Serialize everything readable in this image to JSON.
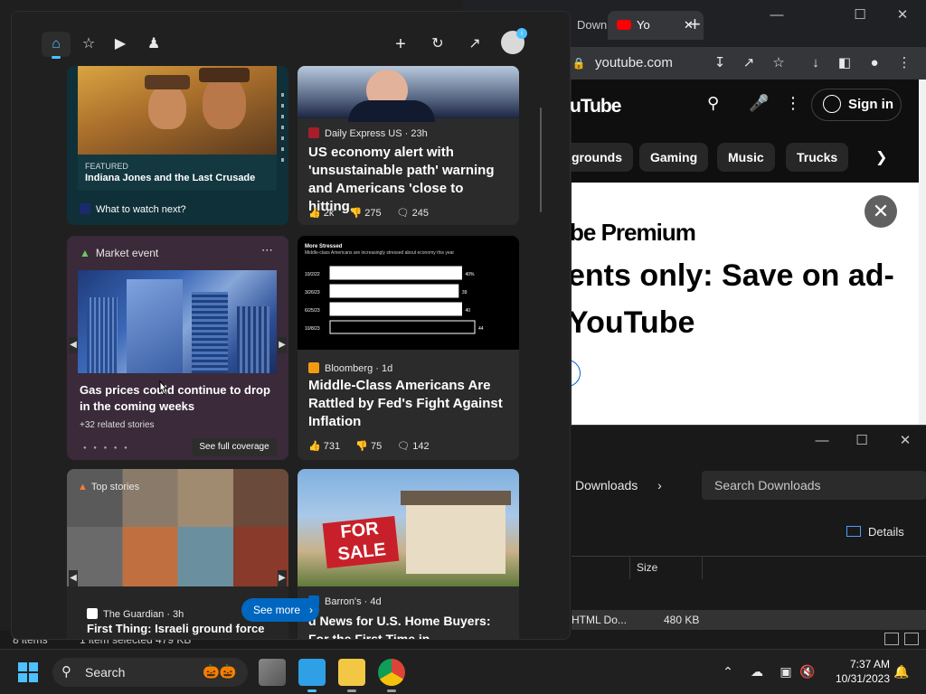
{
  "chrome": {
    "tabs": [
      {
        "label": "Downl"
      },
      {
        "label": "Yo",
        "close": "✕"
      }
    ],
    "new_tab": "+",
    "url": "youtube.com",
    "youtube": {
      "logo_text": "uTube",
      "sign_in": "Sign in",
      "chips": [
        "grounds",
        "Gaming",
        "Music",
        "Trucks"
      ],
      "premium_brand": "be Premium",
      "premium_line1": "ents only: Save on ad-",
      "premium_line2": "YouTube"
    }
  },
  "explorer": {
    "breadcrumb": "Downloads",
    "search_placeholder": "Search Downloads",
    "details_label": "Details",
    "column_size": "Size",
    "row_type": "HTML Do...",
    "row_size": "480 KB",
    "status_items": "8 items",
    "status_selected": "1 item selected  479 KB"
  },
  "widgets": {
    "cards": {
      "indiana": {
        "tag": "FEATURED",
        "title": "Indiana Jones and the Last Crusade",
        "footer": "What to watch next?"
      },
      "econ": {
        "source": "Daily Express US · 23h",
        "headline": "US economy alert with 'unsustainable path' warning and Americans 'close to hitting...",
        "likes": "2k",
        "dislikes": "275",
        "comments": "245"
      },
      "market": {
        "label": "Market event",
        "headline": "Gas prices could continue to drop in the coming weeks",
        "related": "+32 related stories",
        "coverage": "See full coverage"
      },
      "bloomberg": {
        "chart_title": "More Stressed",
        "chart_subtitle": "Middle-class Americans are increasingly stressed about economy this year",
        "source": "Bloomberg · 1d",
        "headline": "Middle-Class Americans Are Rattled by Fed's Fight Against Inflation",
        "likes": "731",
        "dislikes": "75",
        "comments": "142"
      },
      "top": {
        "label": "Top stories",
        "source": "The Guardian · 3h",
        "headline": "First Thing: Israeli ground force battle Hamas in northern Gaza as"
      },
      "barrons": {
        "source": "Barron's · 4d",
        "headline": "d News for U.S. Home Buyers: For the First Time in"
      }
    },
    "see_more": "See more"
  },
  "chart_data": {
    "type": "bar",
    "title": "More Stressed",
    "subtitle": "Middle-class Americans are increasingly stressed about economy this year",
    "categories": [
      "10/2/22",
      "3/26/23",
      "6/25/23",
      "10/8/23"
    ],
    "values": [
      40,
      39,
      40,
      44
    ],
    "value_labels": [
      "40%",
      "39",
      "40",
      "44"
    ],
    "orientation": "horizontal"
  },
  "taskbar": {
    "search_placeholder": "Search",
    "time": "7:37 AM",
    "date": "10/31/2023"
  }
}
